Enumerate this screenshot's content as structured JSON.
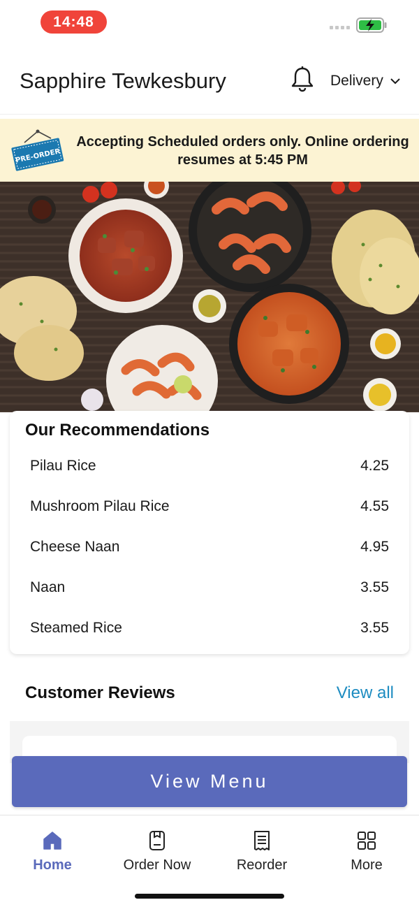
{
  "status_bar": {
    "time": "14:48",
    "time_pill_color": "#f0443a",
    "battery_icon": "battery-charging-icon"
  },
  "header": {
    "store_name": "Sapphire Tewkesbury",
    "notification_icon": "bell-icon",
    "order_mode": "Delivery"
  },
  "banner": {
    "badge": "PRE-ORDER",
    "message": "Accepting Scheduled orders only. Online ordering resumes at 5:45 PM"
  },
  "hero": {
    "icon": "food-photo"
  },
  "recommendations": {
    "title": "Our Recommendations",
    "items": [
      {
        "name": "Pilau Rice",
        "price": "4.25"
      },
      {
        "name": "Mushroom Pilau Rice",
        "price": "4.55"
      },
      {
        "name": "Cheese Naan",
        "price": "4.95"
      },
      {
        "name": "Naan",
        "price": "3.55"
      },
      {
        "name": "Steamed Rice",
        "price": "3.55"
      }
    ]
  },
  "reviews": {
    "title": "Customer Reviews",
    "view_all": "View all"
  },
  "actions": {
    "view_menu": "View Menu",
    "button_color": "#5a6abb"
  },
  "tabbar": {
    "active_color": "#5a6abb",
    "tabs": [
      {
        "label": "Home",
        "icon": "home-icon",
        "active": true
      },
      {
        "label": "Order Now",
        "icon": "order-icon",
        "active": false
      },
      {
        "label": "Reorder",
        "icon": "receipt-icon",
        "active": false
      },
      {
        "label": "More",
        "icon": "grid-icon",
        "active": false
      }
    ]
  }
}
